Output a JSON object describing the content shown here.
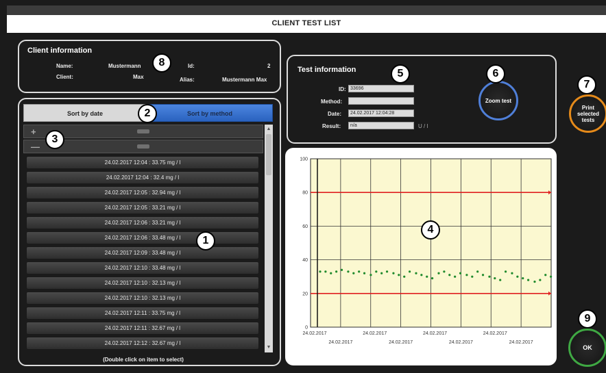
{
  "window": {
    "title": "CLIENT TEST LIST"
  },
  "client": {
    "heading": "Client information",
    "name_label": "Name:",
    "name_value": "Mustermann",
    "client_label": "Client:",
    "client_value": "Max",
    "id_label": "Id:",
    "id_value": "2",
    "alias_label": "Alias:",
    "alias_value": "Mustermann Max"
  },
  "sort": {
    "by_date": "Sort by date",
    "by_method": "Sort by method"
  },
  "groups": [
    {
      "sign": "+"
    },
    {
      "sign": "—"
    }
  ],
  "items": [
    "24.02.2017 12:04 : 33.75 mg / l",
    "24.02.2017 12:04 : 32.4 mg / l",
    "24.02.2017 12:05 : 32.94 mg / l",
    "24.02.2017 12:05 : 33.21 mg / l",
    "24.02.2017 12:06 : 33.21 mg / l",
    "24.02.2017 12:06 : 33.48 mg / l",
    "24.02.2017 12:09 : 33.48 mg / l",
    "24.02.2017 12:10 : 33.48 mg / l",
    "24.02.2017 12:10 : 32.13 mg / l",
    "24.02.2017 12:10 : 32.13 mg / l",
    "24.02.2017 12:11 : 33.75 mg / l",
    "24.02.2017 12:11 : 32.67 mg / l",
    "24.02.2017 12:12 : 32.67 mg / l"
  ],
  "list_hint": "(Double click on item to select)",
  "test": {
    "heading": "Test information",
    "id_label": "ID:",
    "id_value": "33696",
    "method_label": "Method:",
    "method_value": "",
    "date_label": "Date:",
    "date_value": "24.02.2017 12:04:28",
    "result_label": "Result:",
    "result_value": "n/a",
    "result_unit": "U / l"
  },
  "buttons": {
    "zoom": "Zoom test",
    "print": "Print selected tests",
    "ok": "OK"
  },
  "markers": [
    "1",
    "2",
    "3",
    "4",
    "5",
    "6",
    "7",
    "8",
    "9"
  ],
  "colors": {
    "accent_blue": "#3a78d6",
    "zoom_ring": "#4f7fd8",
    "print_ring": "#e58a1a",
    "ok_ring": "#3fa843",
    "limit_line": "#e02020",
    "series": "#1f8a2c",
    "plot_bg": "#fbf8d0"
  },
  "chart_data": {
    "type": "scatter",
    "ylim": [
      0,
      100
    ],
    "yticks": [
      "0",
      "20",
      "40",
      "60",
      "80",
      "100"
    ],
    "xticks_top": [
      "24.02.2017",
      "24.02.2017",
      "24.02.2017",
      "24.02.2017"
    ],
    "xticks_bottom": [
      "24.02.2017",
      "24.02.2017",
      "24.02.2017",
      "24.02.2017"
    ],
    "reference_lines": [
      80,
      20
    ],
    "series": [
      {
        "values": [
          33,
          33,
          32,
          33,
          34,
          33,
          32,
          33,
          32,
          31,
          33,
          32,
          33,
          32,
          31,
          30,
          33,
          32,
          31,
          30,
          29,
          32,
          33,
          31,
          30,
          32,
          31,
          30,
          33,
          31,
          30,
          29,
          28,
          33,
          32,
          30,
          29,
          28,
          27,
          28,
          31,
          30
        ]
      }
    ],
    "grid": true
  }
}
